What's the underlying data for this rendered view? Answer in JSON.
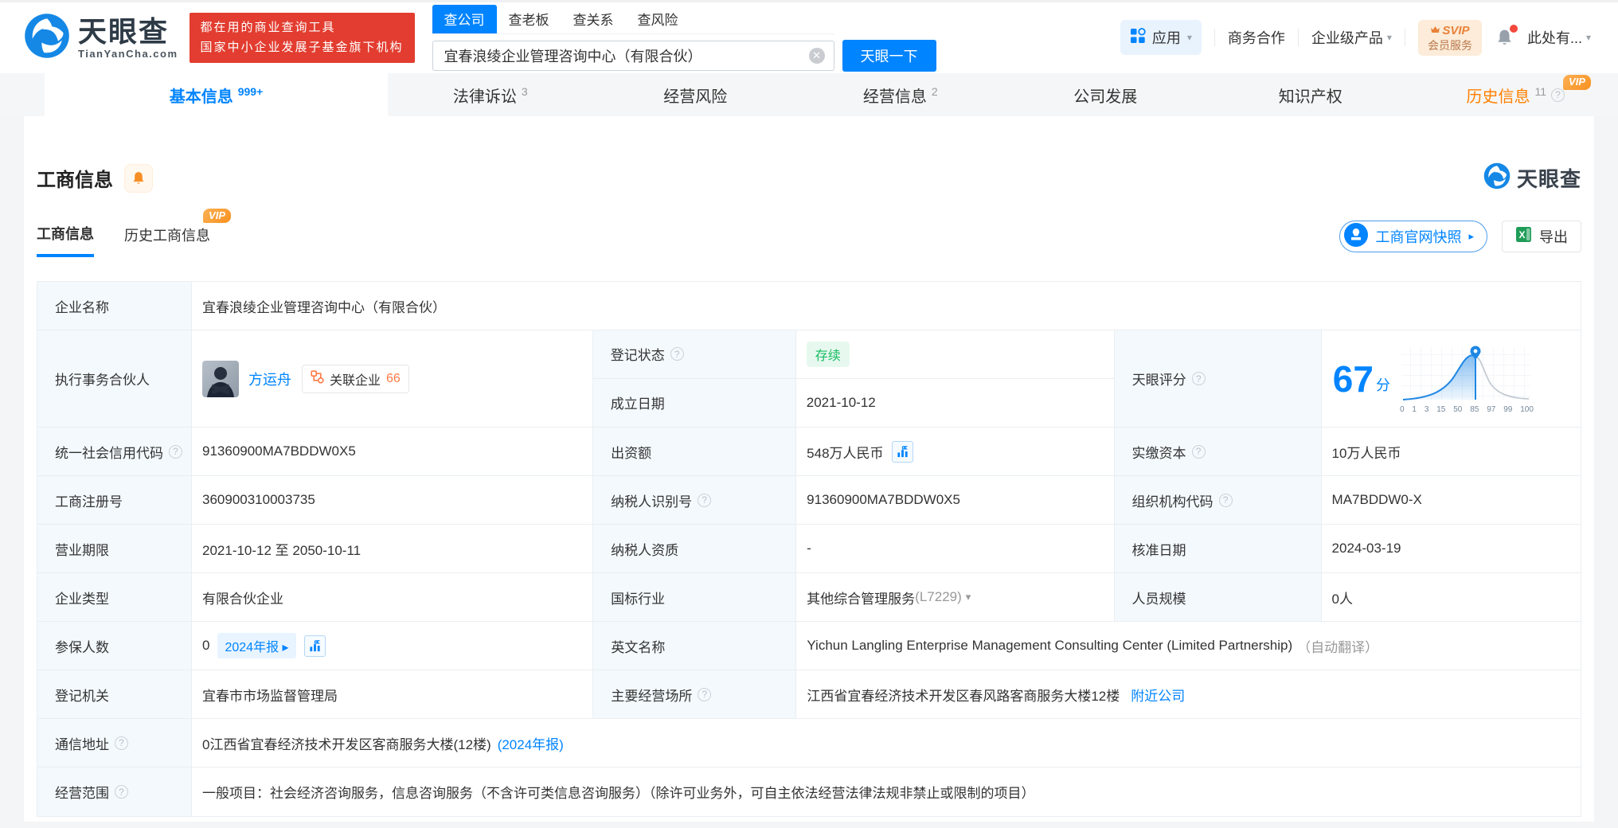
{
  "brand": {
    "name": "天眼查",
    "domain": "TianYanCha.com"
  },
  "promo": {
    "line1": "都在用的商业查询工具",
    "line2": "国家中小企业发展子基金旗下机构"
  },
  "search": {
    "tabs": [
      "查公司",
      "查老板",
      "查关系",
      "查风险"
    ],
    "value": "宜春浪绫企业管理咨询中心（有限合伙）",
    "submit": "天眼一下"
  },
  "topnav": {
    "apps": "应用",
    "cooperation": "商务合作",
    "enterprise": "企业级产品",
    "svip_top": "SVIP",
    "svip_bottom": "会员服务",
    "account": "此处有...",
    "vip": "VIP"
  },
  "tabs": [
    {
      "label": "基本信息",
      "count": "999+"
    },
    {
      "label": "法律诉讼",
      "count": "3"
    },
    {
      "label": "经营风险",
      "count": ""
    },
    {
      "label": "经营信息",
      "count": "2"
    },
    {
      "label": "公司发展",
      "count": ""
    },
    {
      "label": "知识产权",
      "count": ""
    },
    {
      "label": "历史信息",
      "count": "11"
    }
  ],
  "section": {
    "title": "工商信息",
    "watermark": "天眼查",
    "subtab_active": "工商信息",
    "subtab_history": "历史工商信息",
    "snapshot": "工商官网快照",
    "export": "导出"
  },
  "fields": {
    "company_name": {
      "label": "企业名称",
      "value": "宜春浪绫企业管理咨询中心（有限合伙）"
    },
    "partner": {
      "label": "执行事务合伙人",
      "name": "方运舟",
      "related_label": "关联企业",
      "related_count": "66"
    },
    "reg_status": {
      "label": "登记状态",
      "value": "存续"
    },
    "est_date": {
      "label": "成立日期",
      "value": "2021-10-12"
    },
    "tyc_score": {
      "label": "天眼评分",
      "value": "67",
      "unit": "分"
    },
    "credit_code": {
      "label": "统一社会信用代码",
      "value": "91360900MA7BDDW0X5"
    },
    "capital": {
      "label": "出资额",
      "value": "548万人民币"
    },
    "paid_capital": {
      "label": "实缴资本",
      "value": "10万人民币"
    },
    "reg_no": {
      "label": "工商注册号",
      "value": "360900310003735"
    },
    "taxpayer_id": {
      "label": "纳税人识别号",
      "value": "91360900MA7BDDW0X5"
    },
    "org_code": {
      "label": "组织机构代码",
      "value": "MA7BDDW0-X"
    },
    "term": {
      "label": "营业期限",
      "value": "2021-10-12 至 2050-10-11"
    },
    "taxpayer_quality": {
      "label": "纳税人资质",
      "value": "-"
    },
    "approved": {
      "label": "核准日期",
      "value": "2024-03-19"
    },
    "company_type": {
      "label": "企业类型",
      "value": "有限合伙企业"
    },
    "industry": {
      "label": "国标行业",
      "value": "其他综合管理服务",
      "code": "(L7229)"
    },
    "staff": {
      "label": "人员规模",
      "value": "0人"
    },
    "insured": {
      "label": "参保人数",
      "value": "0",
      "badge": "2024年报"
    },
    "english": {
      "label": "英文名称",
      "value": "Yichun Langling Enterprise Management Consulting Center (Limited Partnership)",
      "note": "（自动翻译）"
    },
    "authority": {
      "label": "登记机关",
      "value": "宜春市市场监督管理局"
    },
    "place": {
      "label": "主要经营场所",
      "value": "江西省宜春经济技术开发区春风路客商服务大楼12楼",
      "link": "附近公司"
    },
    "address": {
      "label": "通信地址",
      "value": "0江西省宜春经济技术开发区客商服务大楼(12楼)",
      "link": "(2024年报)"
    },
    "scope": {
      "label": "经营范围",
      "value": "一般项目：社会经济咨询服务，信息咨询服务（不含许可类信息咨询服务）（除许可业务外，可自主依法经营法律法规非禁止或限制的项目）"
    }
  },
  "score_chart": {
    "type": "area",
    "score": 67,
    "unit": "分",
    "ticks": [
      "0",
      "1",
      "3",
      "15",
      "50",
      "85",
      "97",
      "99",
      "100"
    ],
    "marker_at": 67
  }
}
